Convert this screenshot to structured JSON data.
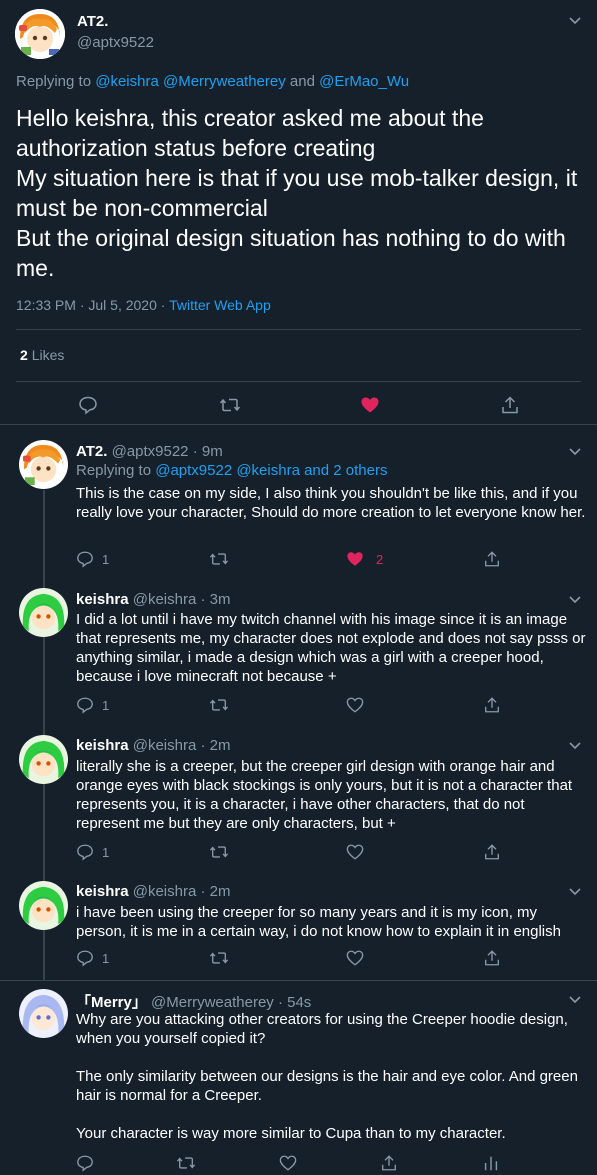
{
  "main_tweet": {
    "name": "AT2.",
    "handle": "@aptx9522",
    "replying_prefix": "Replying to",
    "replying_to": "@keishra @Merryweatherey",
    "replying_and": "and",
    "replying_last": "@ErMao_Wu",
    "text": "Hello keishra, this creator asked me about the authorization status before creating\nMy situation here is that if you use mob-talker design, it must be non-commercial\nBut the original design situation has nothing to do with me.",
    "timestamp": "12:33 PM · Jul 5, 2020 · ",
    "source": "Twitter Web App",
    "likes_count": "2",
    "likes_label": "Likes"
  },
  "replies": [
    {
      "name": "AT2.",
      "meta": "@aptx9522 · 9m",
      "replying_prefix": "Replying to",
      "replying_to": "@aptx9522 @keishra and 2 others",
      "text": "This is the case on my side, I also think you shouldn't be like this, and if you really love your character, Should do more creation to let everyone know her.",
      "reply_count": "1",
      "like_count": "2"
    },
    {
      "name": "keishra",
      "meta": "@keishra · 3m",
      "text": "I did a lot until i have my twitch channel with his image since it is an image that represents me, my character does not explode and does not say psss or anything similar, i made a design which was a girl with a creeper hood, because i love minecraft not because +",
      "reply_count": "1"
    },
    {
      "name": "keishra",
      "meta": "@keishra · 2m",
      "text": "literally she is a creeper, but the creeper girl design with orange hair and orange eyes with black stockings is only yours, but it is not a character that represents you, it is a character, i have other characters, that do not represent me but they are only characters, but +",
      "reply_count": "1"
    },
    {
      "name": "keishra",
      "meta": "@keishra · 2m",
      "text": "i have been using the creeper for so many years and it is my icon, my person, it is me in a certain way, i do not know how to explain it in english",
      "reply_count": "1"
    },
    {
      "name": "「Merry」",
      "meta": "@Merryweatherey · 54s",
      "text": "Why are you attacking other creators for using the Creeper hoodie design, when you yourself copied it?\n\nThe only similarity between our designs is the hair and eye color. And green hair is normal for a Creeper.\n\nYour character is way more similar to Cupa than to my character."
    }
  ],
  "colors": {
    "background": "#15202b",
    "divider": "#38444d",
    "muted": "#8899a6",
    "link": "#1da1f2",
    "like": "#e0245e"
  },
  "icons": [
    "chevron-down-icon",
    "reply-icon",
    "retweet-icon",
    "heart-icon",
    "share-icon",
    "analytics-icon"
  ]
}
